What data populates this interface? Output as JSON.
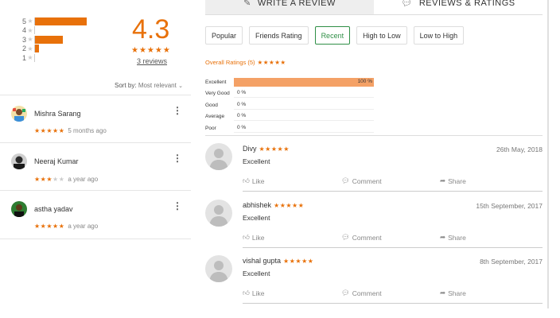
{
  "left": {
    "histogram": [
      {
        "num": "5",
        "fraction": 0.84
      },
      {
        "num": "4",
        "fraction": 0
      },
      {
        "num": "3",
        "fraction": 0.46
      },
      {
        "num": "2",
        "fraction": 0.07
      },
      {
        "num": "1",
        "fraction": 0
      }
    ],
    "score": "4.3",
    "stars": "★★★★★",
    "review_count": "3 reviews",
    "sort_label": "Sort by:",
    "sort_value": "Most relevant",
    "reviews": [
      {
        "name": "Mishra Sarang",
        "rating": 5,
        "time": "5 months ago"
      },
      {
        "name": "Neeraj Kumar",
        "rating": 3,
        "time": "a year ago"
      },
      {
        "name": "astha yadav",
        "rating": 5,
        "time": "a year ago"
      }
    ]
  },
  "right": {
    "tabs": {
      "write": "WRITE A REVIEW",
      "reviews": "REVIEWS & RATINGS"
    },
    "filters": [
      "Popular",
      "Friends Rating",
      "Recent",
      "High to Low",
      "Low to High"
    ],
    "active_filter": "Recent",
    "overall_label": "Overall Ratings (5)",
    "overall_stars": "★★★★★",
    "rating_bars": [
      {
        "label": "Excellent",
        "percent": 100,
        "pct_text": "100 %"
      },
      {
        "label": "Very Good",
        "percent": 0,
        "pct_text": "0 %"
      },
      {
        "label": "Good",
        "percent": 0,
        "pct_text": "0 %"
      },
      {
        "label": "Average",
        "percent": 0,
        "pct_text": "0 %"
      },
      {
        "label": "Poor",
        "percent": 0,
        "pct_text": "0 %"
      }
    ],
    "reviews": [
      {
        "name": "Divy",
        "stars": "★★★★★",
        "date": "26th May, 2018",
        "text": "Excellent"
      },
      {
        "name": "abhishek",
        "stars": "★★★★★",
        "date": "15th September, 2017",
        "text": "Excellent"
      },
      {
        "name": "vishal gupta",
        "stars": "★★★★★",
        "date": "8th September, 2017",
        "text": "Excellent"
      }
    ],
    "actions": {
      "like": "Like",
      "comment": "Comment",
      "share": "Share"
    }
  },
  "colors": {
    "accent": "#e8710a",
    "bar": "#f4a166",
    "active": "#2f8f46"
  },
  "icons": [
    "pencil-icon",
    "chat-bubble-icon",
    "thumbs-up-icon",
    "comment-icon",
    "share-icon",
    "more-vert-icon",
    "user-placeholder-icon"
  ]
}
